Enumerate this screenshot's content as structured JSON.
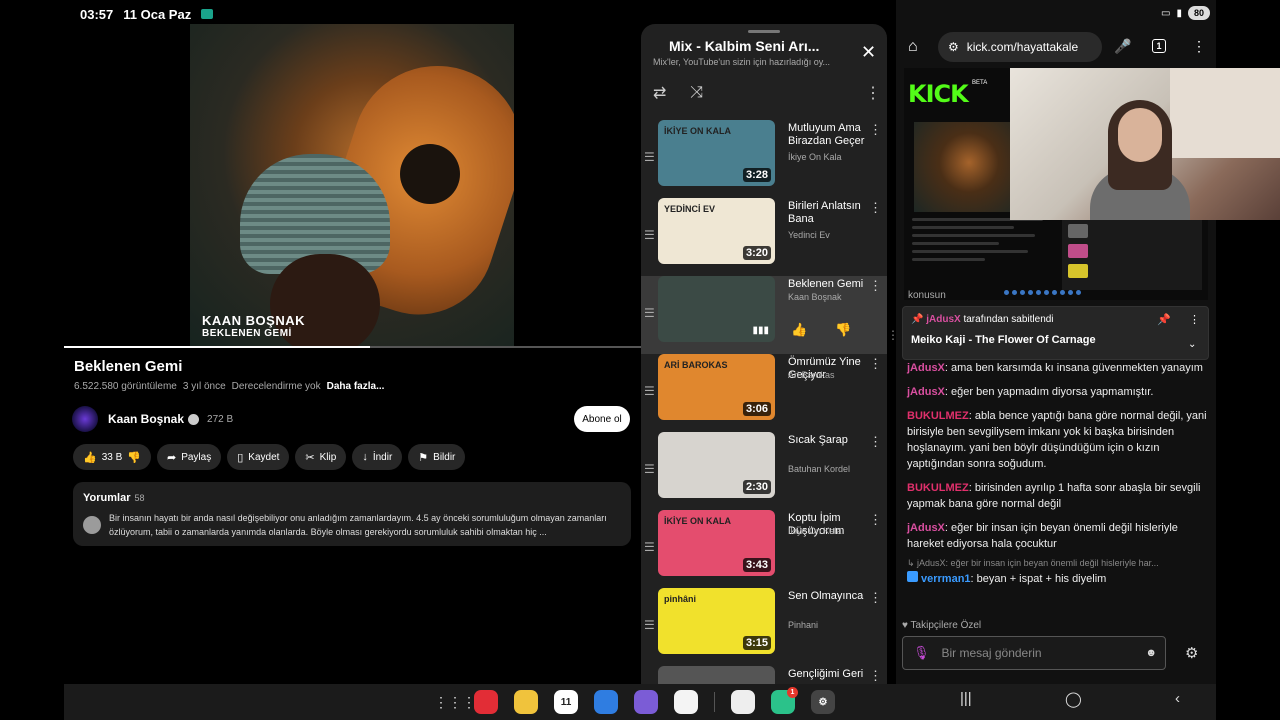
{
  "status": {
    "time": "03:57",
    "date": "11 Oca Paz",
    "battery": "80"
  },
  "video": {
    "overlay_artist": "KAAN BOŞNAK",
    "overlay_track": "BEKLENEN GEMİ",
    "progress": 0.53,
    "title": "Beklenen Gemi",
    "views": "6.522.580 görüntüleme",
    "age": "3 yıl önce",
    "rating": "Derecelendirme yok",
    "more": "Daha fazla...",
    "channel": "Kaan Boşnak",
    "subscribers": "272 B",
    "subscribe": "Abone ol",
    "actions": {
      "likes": "33 B",
      "share": "Paylaş",
      "save": "Kaydet",
      "clip": "Klip",
      "download": "İndir",
      "report": "Bildir"
    },
    "comments": {
      "label": "Yorumlar",
      "count": "58",
      "text": "Bir insanın hayatı bir anda nasıl değişebiliyor onu anladığım zamanlardayım. 4.5 ay önceki sorumluluğum olmayan zamanları özlüyorum, tabii o zamanlarda yanımda olanlarda. Böyle olması gerekiyordu sorumluluk sahibi olmaktan hiç ..."
    }
  },
  "playlist": {
    "title": "Mix - Kalbim Seni Arı...",
    "subtitle": "Mix'ler, YouTube'un sizin için hazırladığı oy...",
    "items": [
      {
        "title": "Mutluyum Ama Birazdan Geçer",
        "artist": "İkiye On Kala",
        "duration": "3:28",
        "thumb_text": "İKİYE ON KALA",
        "bg": "#4a7f8f"
      },
      {
        "title": "Birileri Anlatsın Bana",
        "artist": "Yedinci Ev",
        "duration": "3:20",
        "thumb_text": "YEDİNCİ EV",
        "bg": "#efe7d4"
      },
      {
        "title": "Beklenen Gemi",
        "artist": "Kaan Boşnak",
        "duration": "",
        "thumb_text": "",
        "bg": "#3b4a45"
      },
      {
        "title": "Ömrümüz Yine Geçiyor",
        "artist": "Ari Barokas",
        "duration": "3:06",
        "thumb_text": "ARİ BAROKAS",
        "bg": "#e0872e"
      },
      {
        "title": "Sıcak Şarap",
        "artist": "Batuhan Kordel",
        "duration": "2:30",
        "thumb_text": "",
        "bg": "#d7d4cf"
      },
      {
        "title": "Koptu İpim Düşüyorum",
        "artist": "İkiye On Kala",
        "duration": "3:43",
        "thumb_text": "İKİYE ON KALA",
        "bg": "#e44d6e"
      },
      {
        "title": "Sen Olmayınca",
        "artist": "Pinhani",
        "duration": "3:15",
        "thumb_text": "pinhâni",
        "bg": "#f1e12c"
      },
      {
        "title": "Gençliğimi Geri",
        "artist": "",
        "duration": "",
        "thumb_text": "",
        "bg": "#555555"
      }
    ]
  },
  "browser": {
    "url": "kick.com/hayattakale",
    "tab_count": "1",
    "kick_logo": "KICK",
    "kick_beta": "BETA",
    "chat_above": "konusun",
    "pinned_by_user": "jAdusX",
    "pinned_by_suffix": "tarafından sabitlendi",
    "pinned_text": "Meiko Kaji - The Flower Of Carnage",
    "messages": [
      {
        "user": "jAdusX",
        "color": "#d94fa0",
        "text": "ama ben karsımda kı insana güvenmekten yanayım"
      },
      {
        "user": "jAdusX",
        "color": "#d94fa0",
        "text": "eğer ben yapmadım diyorsa yapmamıştır."
      },
      {
        "user": "BUKULMEZ",
        "color": "#e1306c",
        "text": "abla bence yaptığı bana göre normal değil, yani birisiyle ben sevgiliysem imkanı yok ki başka birisinden hoşlanayım. yani ben böylr düşündüğüm için o kızın yaptığından sonra soğudum."
      },
      {
        "user": "BUKULMEZ",
        "color": "#e1306c",
        "text": "birisinden ayrılıp 1 hafta sonr abaşla bir sevgili yapmak bana göre normal değil"
      },
      {
        "user": "jAdusX",
        "color": "#d94fa0",
        "text": "eğer bir insan için beyan önemli değil hisleriyle hareket ediyorsa hala çocuktur"
      }
    ],
    "reply_preview": "↳ jAdusX: eğer bir insan için beyan önemli değil hisleriyle har...",
    "last_message": {
      "user": "verrman1",
      "color": "#3a9bff",
      "text": "beyan + ispat + his diyelim"
    },
    "followers_label": "Takipçilere Özel",
    "input_placeholder": "Bir mesaj gönderin"
  },
  "taskbar": {
    "calendar_day": "11",
    "notification_badge": "1"
  }
}
